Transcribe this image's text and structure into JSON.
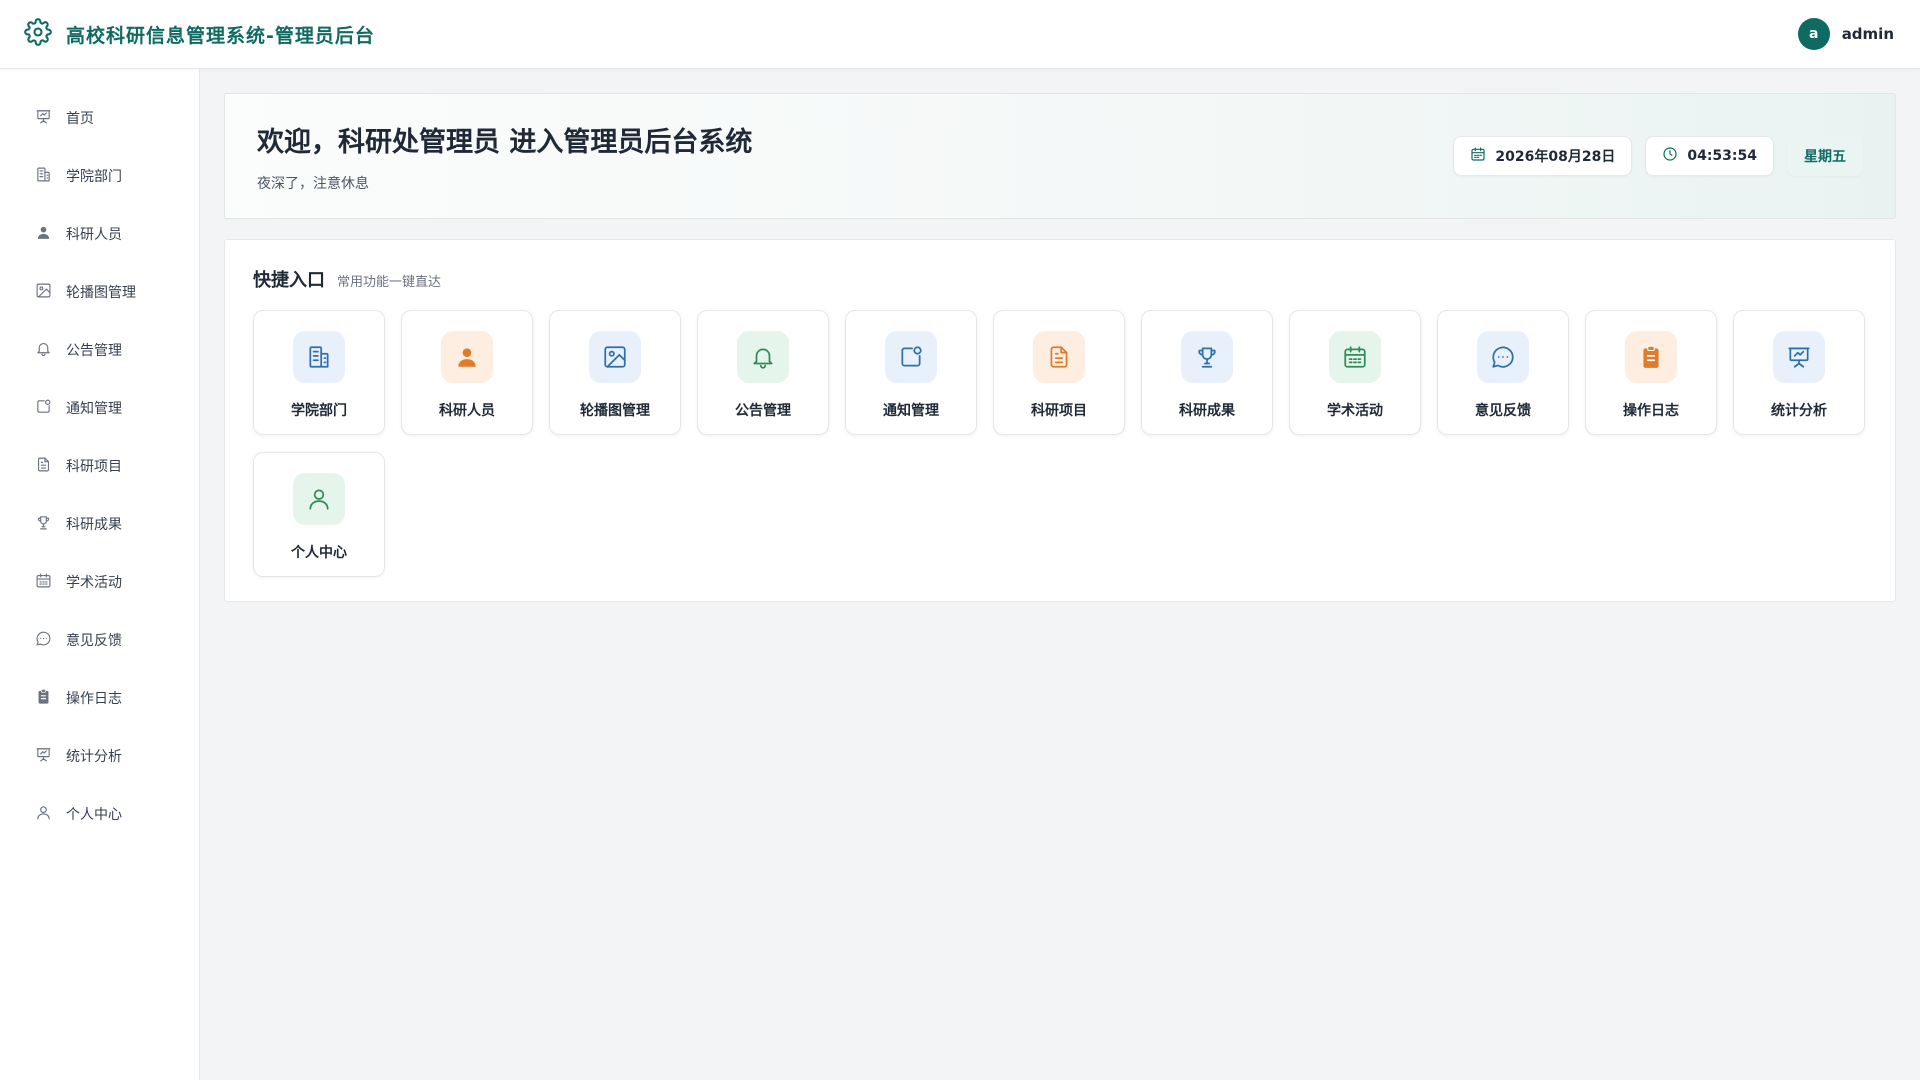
{
  "header": {
    "title": "高校科研信息管理系统-管理员后台",
    "avatar_letter": "a",
    "username": "admin"
  },
  "colors": {
    "brand": "#0f6b62",
    "icon_blue": "#2f6fa8",
    "icon_orange": "#e07b2a",
    "icon_green": "#2e8b57",
    "sidebar_icon": "#6b7280"
  },
  "sidebar": {
    "items": [
      {
        "label": "首页",
        "icon": "presentation-icon"
      },
      {
        "label": "学院部门",
        "icon": "building-icon"
      },
      {
        "label": "科研人员",
        "icon": "user-solid-icon"
      },
      {
        "label": "轮播图管理",
        "icon": "image-icon"
      },
      {
        "label": "公告管理",
        "icon": "bell-icon"
      },
      {
        "label": "通知管理",
        "icon": "notification-icon"
      },
      {
        "label": "科研项目",
        "icon": "document-icon"
      },
      {
        "label": "科研成果",
        "icon": "trophy-icon"
      },
      {
        "label": "学术活动",
        "icon": "calendar-icon"
      },
      {
        "label": "意见反馈",
        "icon": "chat-icon"
      },
      {
        "label": "操作日志",
        "icon": "clipboard-icon"
      },
      {
        "label": "统计分析",
        "icon": "presentation-icon"
      },
      {
        "label": "个人中心",
        "icon": "user-outline-icon"
      }
    ]
  },
  "welcome": {
    "title": "欢迎，科研处管理员 进入管理员后台系统",
    "subtitle": "夜深了，注意休息",
    "date": "2026年08月28日",
    "time": "04:53:54",
    "weekday": "星期五"
  },
  "quick": {
    "title": "快捷入口",
    "subtitle": "常用功能一键直达",
    "items": [
      {
        "label": "学院部门",
        "icon": "building-icon",
        "tone": "blue"
      },
      {
        "label": "科研人员",
        "icon": "user-solid-icon",
        "tone": "orange"
      },
      {
        "label": "轮播图管理",
        "icon": "image-icon",
        "tone": "blue"
      },
      {
        "label": "公告管理",
        "icon": "bell-icon",
        "tone": "green"
      },
      {
        "label": "通知管理",
        "icon": "notification-icon",
        "tone": "blue"
      },
      {
        "label": "科研项目",
        "icon": "document-icon",
        "tone": "orange"
      },
      {
        "label": "科研成果",
        "icon": "trophy-icon",
        "tone": "blue"
      },
      {
        "label": "学术活动",
        "icon": "calendar-icon",
        "tone": "green"
      },
      {
        "label": "意见反馈",
        "icon": "chat-icon",
        "tone": "blue"
      },
      {
        "label": "操作日志",
        "icon": "clipboard-icon",
        "tone": "orange"
      },
      {
        "label": "统计分析",
        "icon": "presentation-icon",
        "tone": "blue"
      },
      {
        "label": "个人中心",
        "icon": "user-outline-icon",
        "tone": "green"
      }
    ]
  }
}
